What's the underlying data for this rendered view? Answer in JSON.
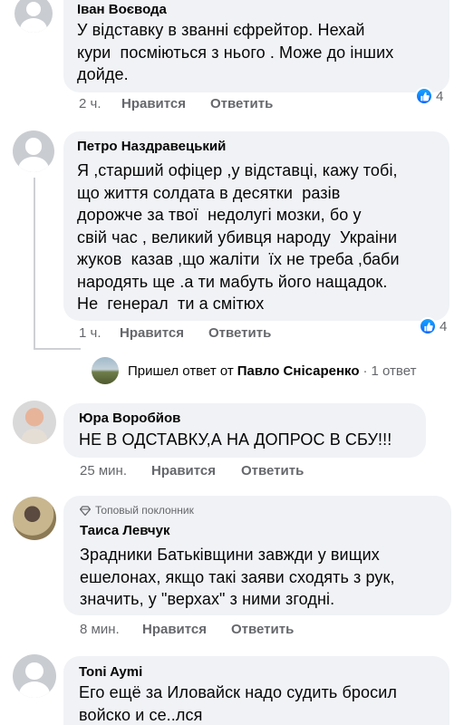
{
  "comments": [
    {
      "author": "Іван Воєвода",
      "text": "У відставку в званні єфрейтор. Нехай\nкури  посміються з нього . Може до інших\nдойде.",
      "time": "2 ч.",
      "like_label": "Нравится",
      "reply_label": "Ответить",
      "reaction_count": "4"
    },
    {
      "author": "Петро Наздравецький",
      "text": "Я ,старший офіцер ,у відставці, кажу тобі,\nщо життя солдата в десятки  разів\nдорожче за твої  недолугі мозки, бо у\nсвій час , великий убивця народу  Украіни\nжуков  казав ,що жаліти  їх не треба ,баби\nнародять ще .а ти мабуть його нащадок.\nНе  генерал  ти а смітюх",
      "time": "1 ч.",
      "like_label": "Нравится",
      "reply_label": "Ответить",
      "reaction_count": "4",
      "replies_summary": {
        "prefix": "Пришел ответ от",
        "replier": "Павло Снісаренко",
        "count": "1 ответ"
      }
    },
    {
      "author": "Юра Воробйов",
      "text": "НЕ В ОДСТАВКУ,А НА ДОПРОС В СБУ!!!",
      "time": "25 мин.",
      "like_label": "Нравится",
      "reply_label": "Ответить"
    },
    {
      "badge": "Топовый поклонник",
      "author": "Таиса Левчук",
      "text": "Зрадники Батьківщини завжди у вищих\nешелонах, якщо такі заяви сходять з рук,\nзначить, у \"верхах\" з ними згодні.",
      "time": "8 мин.",
      "like_label": "Нравится",
      "reply_label": "Ответить"
    },
    {
      "author": "Toni Aymi",
      "text": "Его ещё за Иловайск надо судить бросил\nвойско и се..лся"
    }
  ],
  "colors": {
    "bubble": "#f0f2f5",
    "meta_text": "#65676b",
    "like_blue": "#0866ff"
  },
  "icons": {
    "reaction": "like-thumbs-up-icon",
    "badge": "diamond-icon"
  }
}
